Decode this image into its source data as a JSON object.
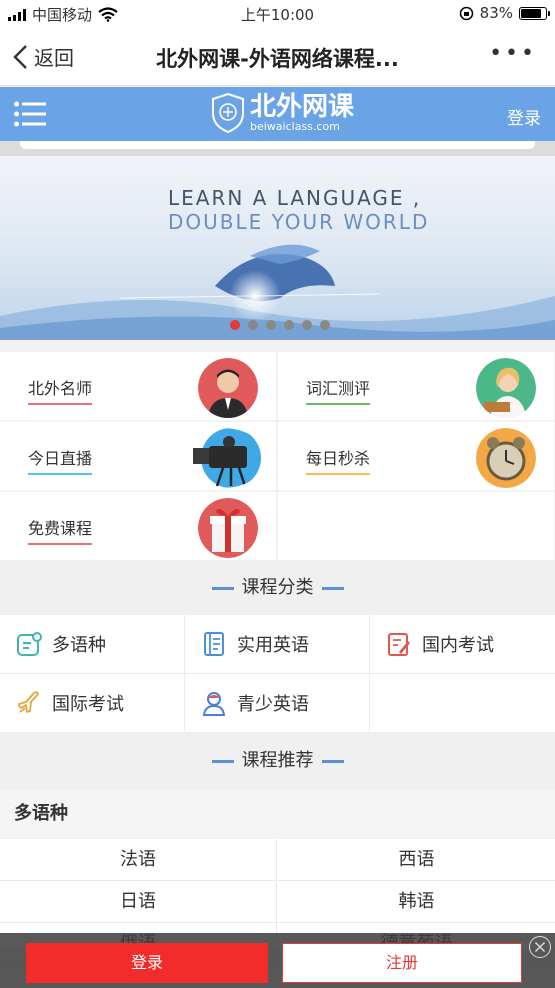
{
  "status": {
    "carrier": "中国移动",
    "time": "上午10:00",
    "battery": "83%",
    "battery_level": 0.83
  },
  "nav": {
    "back_label": "返回",
    "title": "北外网课-外语网络课程...",
    "more": "•••"
  },
  "site": {
    "brand": "北外网课",
    "url": "beiwaiclass.com",
    "login": "登录"
  },
  "banner": {
    "line1": "LEARN A LANGUAGE ,",
    "line2": "DOUBLE YOUR WORLD",
    "slide_count": 6,
    "active_slide": 0
  },
  "quick": [
    {
      "label": "北外名师",
      "accent": "#e57373"
    },
    {
      "label": "词汇测评",
      "accent": "#66bb6a"
    },
    {
      "label": "今日直播",
      "accent": "#4fc3f7"
    },
    {
      "label": "每日秒杀",
      "accent": "#ffb74d"
    },
    {
      "label": "免费课程",
      "accent": "#e57373"
    }
  ],
  "categories_title": "课程分类",
  "categories": [
    {
      "label": "多语种",
      "icon": "multilingual-icon"
    },
    {
      "label": "实用英语",
      "icon": "book-icon"
    },
    {
      "label": "国内考试",
      "icon": "exam-icon"
    },
    {
      "label": "国际考试",
      "icon": "plane-icon"
    },
    {
      "label": "青少英语",
      "icon": "child-icon"
    }
  ],
  "recommend_title": "课程推荐",
  "recommend": {
    "group": "多语种",
    "items": [
      "法语",
      "西语",
      "日语",
      "韩语",
      "俄语",
      "德意葡语"
    ]
  },
  "bottom": {
    "login": "登录",
    "register": "注册"
  }
}
